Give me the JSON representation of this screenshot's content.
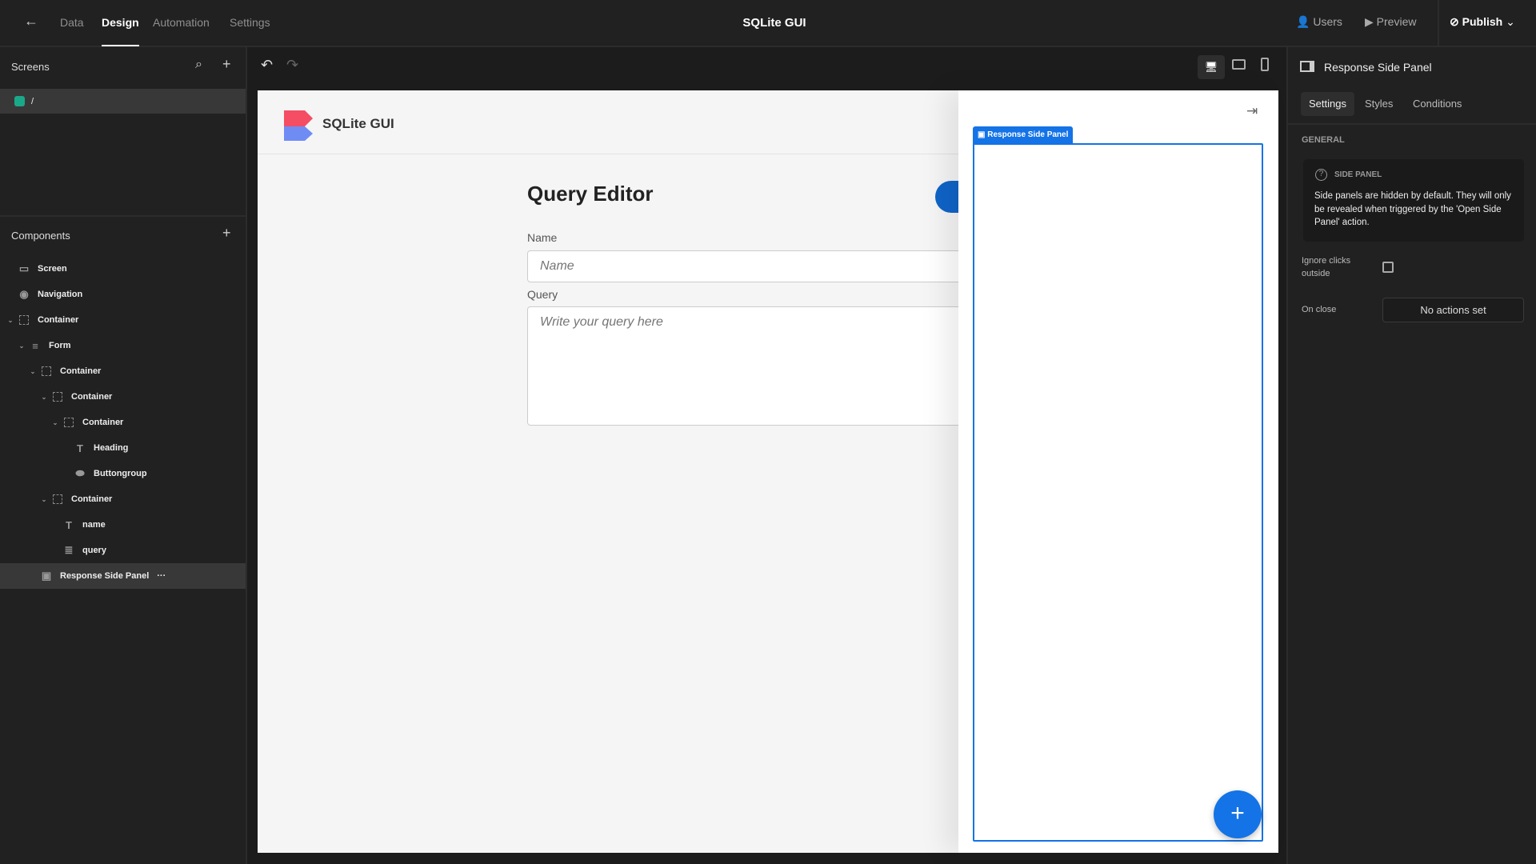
{
  "topbar": {
    "tabs": [
      "Data",
      "Design",
      "Automation",
      "Settings"
    ],
    "active_tab": "Design",
    "title": "SQLite GUI",
    "users": "Users",
    "preview": "Preview",
    "publish": "Publish"
  },
  "screens": {
    "header": "Screens",
    "items": [
      {
        "label": "/",
        "color": "#1aa88a"
      }
    ]
  },
  "components": {
    "header": "Components",
    "tree": [
      {
        "label": "Screen",
        "icon": "screen-icon",
        "level": 0,
        "chev": false
      },
      {
        "label": "Navigation",
        "icon": "eye-icon",
        "level": 0,
        "chev": false
      },
      {
        "label": "Container",
        "icon": "container-icon",
        "level": 0,
        "chev": true
      },
      {
        "label": "Form",
        "icon": "form-icon",
        "level": 1,
        "chev": true
      },
      {
        "label": "Container",
        "icon": "container-icon",
        "level": 2,
        "chev": true
      },
      {
        "label": "Container",
        "icon": "container-icon",
        "level": 3,
        "chev": true
      },
      {
        "label": "Container",
        "icon": "container-icon",
        "level": 4,
        "chev": true
      },
      {
        "label": "Heading",
        "icon": "heading-icon",
        "level": 5,
        "chev": false
      },
      {
        "label": "Buttongroup",
        "icon": "buttongroup-icon",
        "level": 5,
        "chev": false
      },
      {
        "label": "Container",
        "icon": "container-icon",
        "level": 3,
        "chev": true
      },
      {
        "label": "name",
        "icon": "text-icon",
        "level": 4,
        "chev": false
      },
      {
        "label": "query",
        "icon": "textarea-icon",
        "level": 4,
        "chev": false
      },
      {
        "label": "Response Side Panel",
        "icon": "side-panel-icon",
        "level": 2,
        "chev": false,
        "selected": true,
        "more": "···"
      }
    ]
  },
  "app": {
    "brand": "SQLite GUI",
    "heading": "Query Editor",
    "name_label": "Name",
    "name_placeholder": "Name",
    "query_label": "Query",
    "query_placeholder": "Write your query here",
    "side_panel_tag": "Response Side Panel",
    "accent": "#1473e6"
  },
  "settings": {
    "title": "Response Side Panel",
    "tabs": [
      "Settings",
      "Styles",
      "Conditions"
    ],
    "active_tab": "Settings",
    "section": "GENERAL",
    "info_title": "SIDE PANEL",
    "info_text": "Side panels are hidden by default. They will only be revealed when triggered by the 'Open Side Panel' action.",
    "ignore_label": "Ignore clicks outside",
    "ignore_checked": false,
    "on_close_label": "On close",
    "on_close_value": "No actions set"
  }
}
